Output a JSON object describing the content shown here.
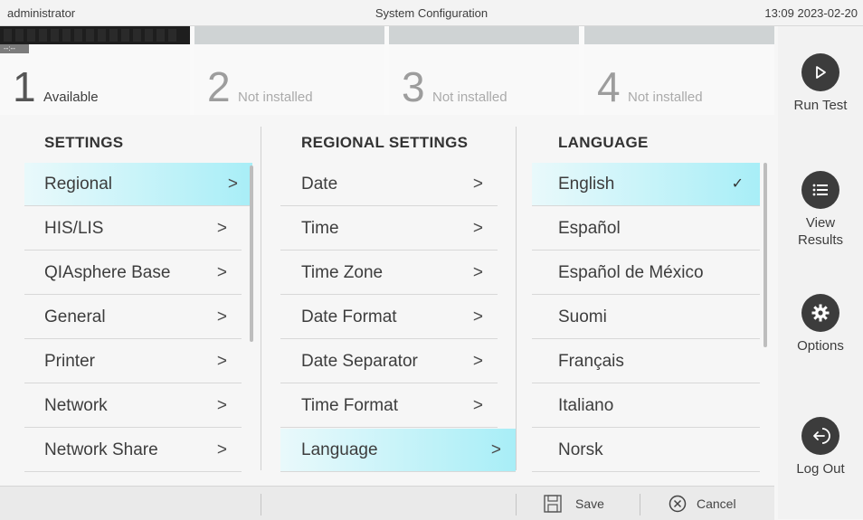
{
  "topbar": {
    "user": "administrator",
    "title": "System Configuration",
    "clock": "13:09 2023-02-20"
  },
  "modules": [
    {
      "number": "1",
      "status": "Available",
      "timer": "--:--"
    },
    {
      "number": "2",
      "status": "Not installed"
    },
    {
      "number": "3",
      "status": "Not installed"
    },
    {
      "number": "4",
      "status": "Not installed"
    }
  ],
  "nav": {
    "run_test": "Run Test",
    "view_results": "View Results",
    "options": "Options",
    "log_out": "Log Out"
  },
  "settings": {
    "heading": "SETTINGS",
    "items": [
      "Regional",
      "HIS/LIS",
      "QIAsphere Base",
      "General",
      "Printer",
      "Network",
      "Network Share"
    ],
    "selected_index": 0
  },
  "regional": {
    "heading": "REGIONAL SETTINGS",
    "items": [
      "Date",
      "Time",
      "Time Zone",
      "Date Format",
      "Date Separator",
      "Time Format",
      "Language"
    ],
    "selected_index": 6
  },
  "language": {
    "heading": "LANGUAGE",
    "items": [
      "English",
      "Español",
      "Español de México",
      "Suomi",
      "Français",
      "Italiano",
      "Norsk"
    ],
    "selected_index": 0
  },
  "bottombar": {
    "save": "Save",
    "cancel": "Cancel"
  },
  "colors": {
    "selection": "#a8eef7",
    "icon_dark": "#3c3c3c"
  }
}
